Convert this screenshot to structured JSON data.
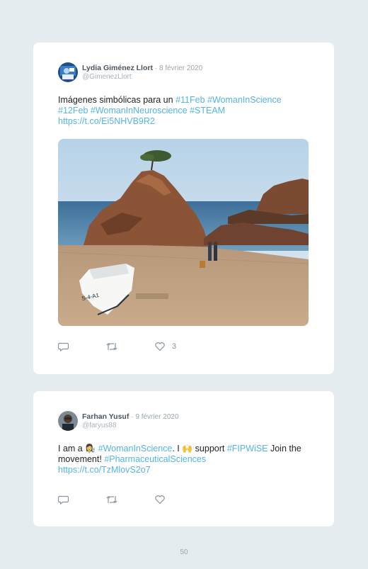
{
  "tweets": [
    {
      "author": "Lydia Giménez Llort",
      "date": "· 8 février 2020",
      "handle": "@GimenezLlort",
      "text_plain": "Imágenes simbólicas para un ",
      "hashtags": [
        "#11Feb",
        "#WomanInScience",
        "#12Feb",
        "#WomanInNeuroscience",
        "#STEAM"
      ],
      "link": "https://t.co/Ei5NHVB9R2",
      "like_count": "3",
      "boat_label": "S-4-A1"
    },
    {
      "author": "Farhan Yusuf",
      "date": "· 9 février 2020",
      "handle": "@faryus88",
      "text_a": "I am a ",
      "emoji_scientist": "👩‍🔬",
      "hashtag_1": "#WomanInScience",
      "text_b": ". I ",
      "emoji_hands": "🙌",
      "text_c": " support ",
      "hashtag_2": "#FIPWiSE",
      "text_d": " Join the movement! ",
      "hashtag_3": "#PharmaceuticalSciences",
      "link": "https://t.co/TzMlovS2o7"
    }
  ],
  "page_number": "50",
  "colors": {
    "background": "#e4ecf0",
    "card": "#ffffff",
    "link": "#55b3e6",
    "muted": "#9aa6ae"
  },
  "icons": [
    "reply-icon",
    "retweet-icon",
    "heart-icon"
  ]
}
